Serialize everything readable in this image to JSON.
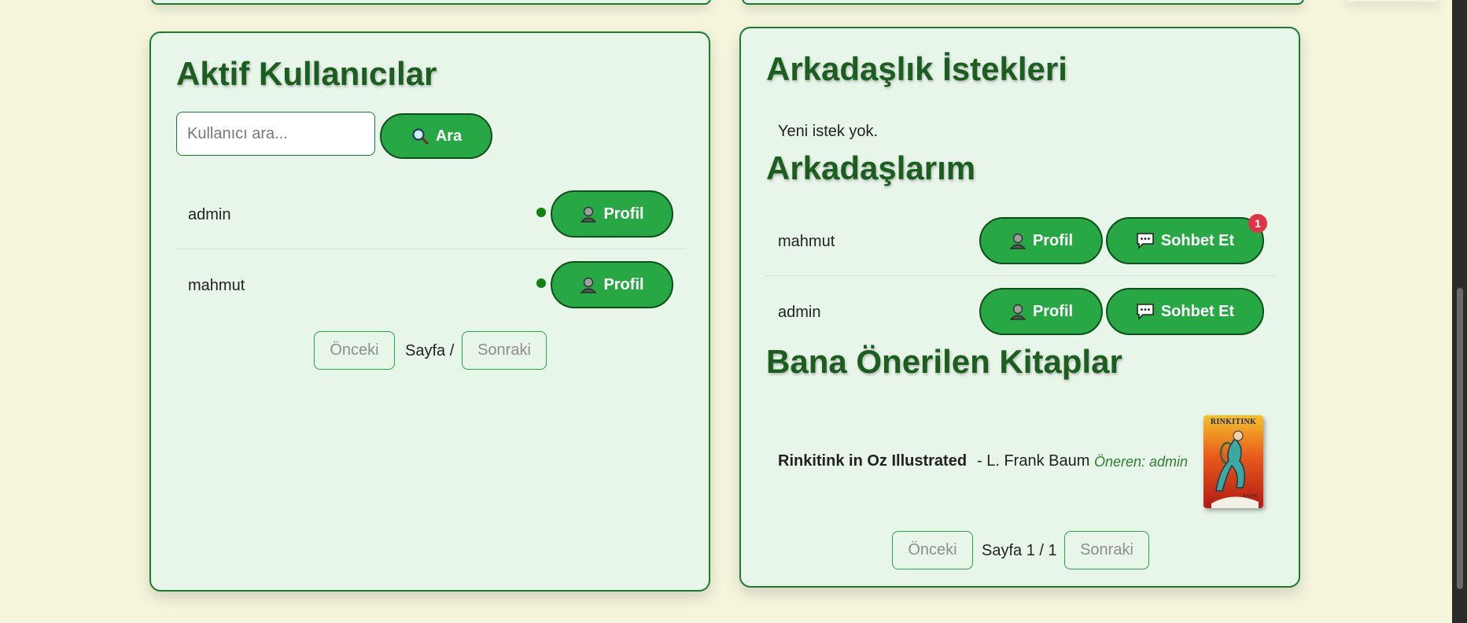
{
  "active_users": {
    "title": "Aktif Kullanıcılar",
    "search_placeholder": "Kullanıcı ara...",
    "search_button": "Ara",
    "users": [
      {
        "name": "admin",
        "online": true,
        "profile_label": "Profil"
      },
      {
        "name": "mahmut",
        "online": true,
        "profile_label": "Profil"
      }
    ],
    "pagination": {
      "prev": "Önceki",
      "page_text": "Sayfa /",
      "next": "Sonraki"
    }
  },
  "friend_requests": {
    "title": "Arkadaşlık İstekleri",
    "empty_text": "Yeni istek yok."
  },
  "friends": {
    "title": "Arkadaşlarım",
    "items": [
      {
        "name": "mahmut",
        "profile_label": "Profil",
        "chat_label": "Sohbet Et",
        "unread": "1"
      },
      {
        "name": "admin",
        "profile_label": "Profil",
        "chat_label": "Sohbet Et"
      }
    ]
  },
  "recommended_books": {
    "title": "Bana Önerilen Kitaplar",
    "items": [
      {
        "title": "Rinkitink in Oz Illustrated",
        "author": "- L. Frank Baum",
        "recommender": "Öneren: admin",
        "cover_text": "RINKITINK"
      }
    ],
    "pagination": {
      "prev": "Önceki",
      "page_text": "Sayfa 1 / 1",
      "next": "Sonraki"
    }
  },
  "colors": {
    "accent": "#28a745",
    "title": "#1b5e20",
    "card_bg": "#e8f5e9",
    "page_bg": "#f5f5dc",
    "badge": "#dc3545"
  }
}
